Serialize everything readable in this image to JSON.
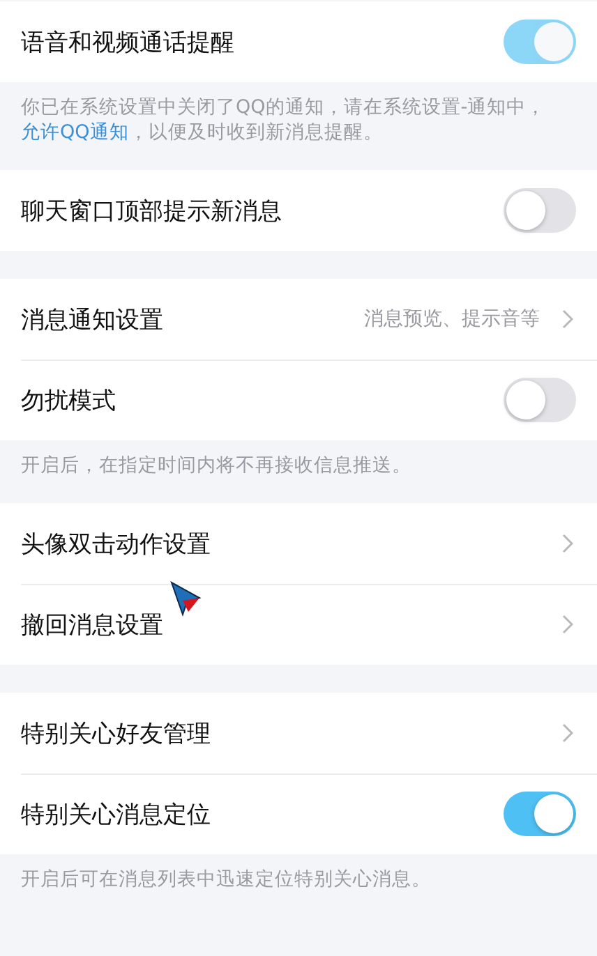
{
  "sections": [
    {
      "items": [
        {
          "kind": "toggle",
          "label": "语音和视频通话提醒",
          "on": true,
          "disabled": true
        }
      ],
      "note": [
        {
          "kind": "text",
          "text": "你已在系统设置中关闭了QQ的通知，请在系统设置-通知中，"
        },
        {
          "kind": "link",
          "text": "允许QQ通知"
        },
        {
          "kind": "text",
          "text": "，以便及时收到新消息提醒。"
        }
      ]
    },
    {
      "items": [
        {
          "kind": "toggle",
          "label": "聊天窗口顶部提示新消息",
          "on": false,
          "disabled": false
        }
      ]
    },
    {
      "items": [
        {
          "kind": "link",
          "label": "消息通知设置",
          "detail": "消息预览、提示音等"
        },
        {
          "kind": "toggle",
          "label": "勿扰模式",
          "on": false,
          "disabled": false
        }
      ],
      "note": [
        {
          "kind": "text",
          "text": "开启后，在指定时间内将不再接收信息推送。"
        }
      ]
    },
    {
      "items": [
        {
          "kind": "link",
          "label": "头像双击动作设置"
        },
        {
          "kind": "link",
          "label": "撤回消息设置"
        }
      ]
    },
    {
      "items": [
        {
          "kind": "link",
          "label": "特别关心好友管理"
        },
        {
          "kind": "toggle",
          "label": "特别关心消息定位",
          "on": true,
          "disabled": false
        }
      ],
      "note": [
        {
          "kind": "text",
          "text": "开启后可在消息列表中迅速定位特别关心消息。"
        }
      ]
    }
  ]
}
